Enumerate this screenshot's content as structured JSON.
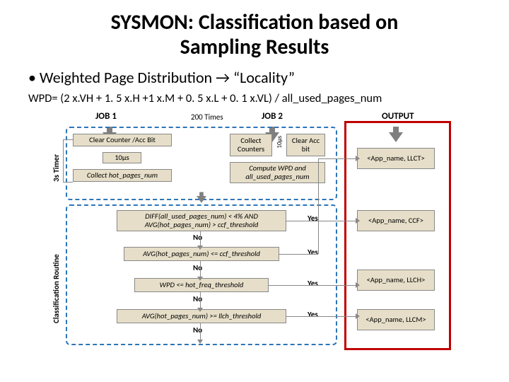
{
  "title_l1": "SYSMON: Classification based on",
  "title_l2": "Sampling Results",
  "bullet": "•  Weighted Page Distribution → “Locality”",
  "formula": "WPD= (2 x.VH + 1. 5 x.H +1 x.M + 0. 5 x.L + 0. 1 x.VL) / all_used_pages_num",
  "cols": {
    "job1": "JOB 1",
    "times": "200 Times",
    "job2": "JOB 2",
    "output": "OUTPUT"
  },
  "side": {
    "timer": "3s Timer",
    "routine": "Classification Routine"
  },
  "job1_boxes": {
    "clear": "Clear Counter /Acc Bit",
    "wait": "10μs",
    "collect": "Collect hot_pages_num"
  },
  "job2_boxes": {
    "collect_counters": "Collect\nCounters",
    "clear_acc": "Clear\nAcc bit",
    "compute": "Compute WPD and\nall_used_pages_num",
    "tiny": "10μs"
  },
  "decisions": {
    "d1": "DIFF(all_used_pages_num) < 4% AND\nAVG(hot_pages_num) > ccf_threshold",
    "d2": "AVG(hot_pages_num) <= ccf_threshold",
    "d3": "WPD <= hot_freq_threshold",
    "d4": "AVG(hot_pages_num) >= llch_threshold"
  },
  "outputs": {
    "o1": "<App_name,\nLLCT>",
    "o2": "<App_name,\nCCF>",
    "o3": "<App_name,\nLLCH>",
    "o4": "<App_name,\nLLCM>"
  },
  "yn": {
    "yes": "Yes",
    "no": "No"
  }
}
